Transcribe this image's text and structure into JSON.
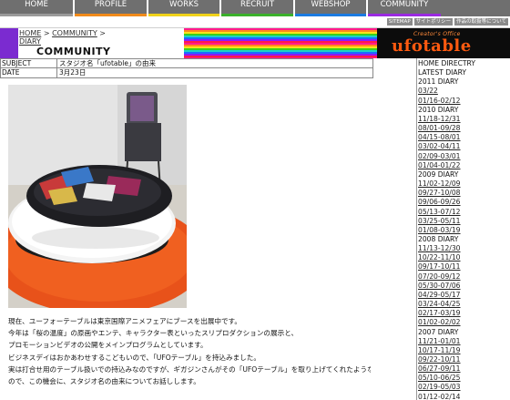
{
  "nav": {
    "items": [
      {
        "label": "HOME",
        "stripe": "#9a9a9a",
        "width": 80
      },
      {
        "label": "PROFILE",
        "stripe": "#f08a1a",
        "width": 79
      },
      {
        "label": "WORKS",
        "stripe": "#f0d21a",
        "width": 78
      },
      {
        "label": "RECRUIT",
        "stripe": "#3ab02a",
        "width": 79
      },
      {
        "label": "WEBSHOP",
        "stripe": "#1a7ae0",
        "width": 78
      },
      {
        "label": "COMMUNITY",
        "stripe": "#9a2ae0",
        "width": 80
      }
    ]
  },
  "utility": {
    "links": [
      "SITEMAP",
      "サイトポリシー",
      "作品の取扱等について"
    ]
  },
  "header": {
    "breadcrumb_home": "HOME",
    "breadcrumb_sep1": " > ",
    "breadcrumb_community": "COMMUNITY",
    "breadcrumb_sep2": " >",
    "breadcrumb_diary": "DIARY",
    "page_title": "COMMUNITY",
    "logo_sub": "Creator's Office",
    "logo_main": "ufotable"
  },
  "meta": {
    "subject_label": "SUBJECT",
    "subject_value": "スタジオ名「ufotable」の由来",
    "date_label": "DATE",
    "date_value": "3月23日"
  },
  "body": {
    "lines": [
      "現在、ユーフォーテーブルは東京国際アニメフェアにブースを出展中です。",
      "今年は「桜の温度」の原画やエンテ、キャラクター表といったスリプロダクションの展示と、",
      "プロモーションビデオの公開をメインプログラムとしています。",
      "ビジネスデイはおかあわせするこどもいので、「UFOテーブル」を持込みました。",
      "実は打合せ用のテーブル扱いでの持込みなのですが、ギガジンさんがその「UFOテーブル」を取り上げてくれたような",
      "ので、この機会に、スタジオ名の由来についてお話しします。"
    ]
  },
  "sidebar": {
    "home_directory": "HOME DIRECTRY",
    "latest_diary": "LATEST DIARY",
    "groups": [
      {
        "year": "2011 DIARY",
        "links": [
          "03/22",
          "01/16-02/12"
        ]
      },
      {
        "year": "2010 DIARY",
        "links": [
          "11/18-12/31",
          "08/01-09/28",
          "04/15-08/01",
          "03/02-04/11",
          "02/09-03/01",
          "01/04-01/22"
        ]
      },
      {
        "year": "2009 DIARY",
        "links": [
          "11/02-12/09",
          "09/27-10/08",
          "09/06-09/26",
          "05/13-07/12",
          "03/25-05/11",
          "01/08-03/19"
        ]
      },
      {
        "year": "2008 DIARY",
        "links": [
          "11/13-12/30",
          "10/22-11/10",
          "09/17-10/11",
          "07/20-09/12",
          "05/30-07/06",
          "04/29-05/17",
          "03/24-04/25",
          "02/17-03/19",
          "01/02-02/02"
        ]
      },
      {
        "year": "2007 DIARY",
        "links": [
          "11/21-01/01",
          "10/17-11/19",
          "09/22-10/11",
          "06/27-09/11",
          "05/10-06/25",
          "02/19-05/03",
          "01/12-02/14",
          "06/29-01/07"
        ]
      }
    ]
  }
}
